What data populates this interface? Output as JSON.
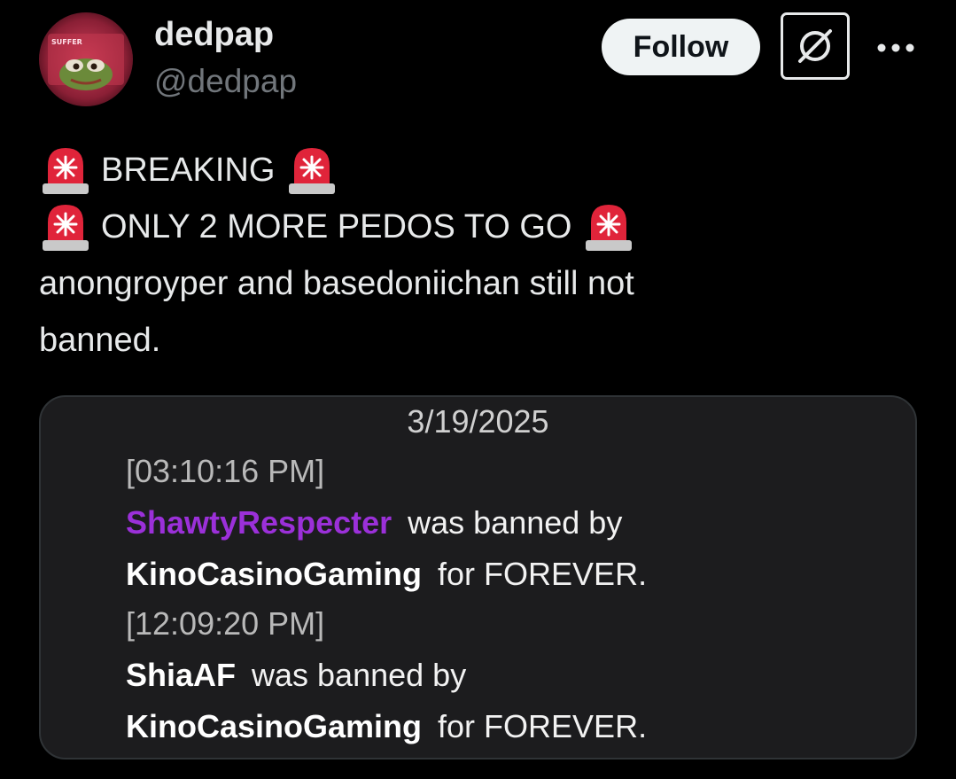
{
  "profile": {
    "display_name": "dedpap",
    "handle": "@dedpap",
    "avatar_icon": "pepe-frog-avatar",
    "avatar_text": "SUFFER"
  },
  "actions": {
    "follow_label": "Follow",
    "grok_icon": "grok-icon",
    "more_icon": "more-dots-icon"
  },
  "tweet": {
    "line1": "BREAKING",
    "line2": "ONLY 2 MORE PEDOS TO GO",
    "line3": "anongroyper and basedoniichan still not",
    "line4": "banned.",
    "emoji": "police-siren-emoji"
  },
  "media": {
    "date": "3/19/2025",
    "entries": [
      {
        "time": "[03:10:16 PM]",
        "user": "ShawtyRespecter",
        "action": "was banned by",
        "by": "KinoCasinoGaming",
        "duration": "for FOREVER."
      },
      {
        "time": "[12:09:20 PM]",
        "user": "ShiaAF",
        "action": "was banned by",
        "by": "KinoCasinoGaming",
        "duration": "for FOREVER."
      }
    ]
  },
  "colors": {
    "background": "#000000",
    "text": "#e7e9ea",
    "secondary": "#71767b",
    "card": "#1c1c1e",
    "banned_user_1": "#9b30d9",
    "siren_red": "#e0243a"
  }
}
